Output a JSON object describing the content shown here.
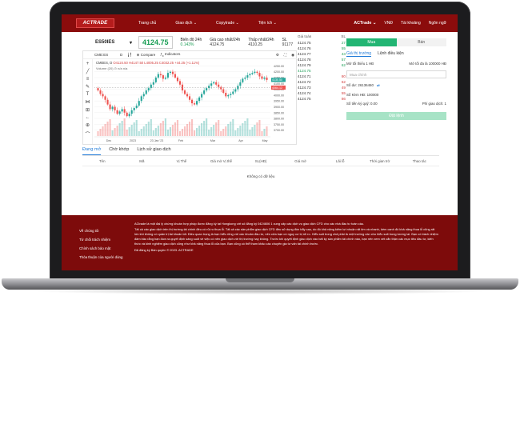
{
  "topbar": {
    "logo": "ACTRADE",
    "nav": [
      "Trang chủ",
      "Giao dịch ⌄",
      "Copytrade ⌄",
      "Tiện ích ⌄"
    ],
    "account": "ACTrade ⌄",
    "currency": "VNĐ",
    "profile": "Tài khoảng",
    "language": "Ngôn ngữ"
  },
  "symbol": {
    "name": "ES50IES",
    "price": "4124.75",
    "stats": [
      {
        "label": "Biến độ 24h",
        "value": "0.143%",
        "green": true
      },
      {
        "label": "Giá cao nhất/24h",
        "value": "4124.75",
        "green": false
      },
      {
        "label": "Thấp nhất/24h",
        "value": "4110.25",
        "green": false
      },
      {
        "label": "SL",
        "value": "91177",
        "green": false
      }
    ]
  },
  "tv": {
    "symbol": "CME:ES",
    "interval": "D",
    "compare": "Compare",
    "indicators": "Indicators",
    "info_symbol": "CMEES, D",
    "ohlc": "O4124.50  H4147.50  L4005.25  C4032.25  +44.25 (+1.11%)",
    "volume": "Volume (20)  ⊙  n/a  n/a"
  },
  "chart_data": {
    "type": "candlestick",
    "title": "",
    "x_ticks": [
      "Dec",
      "2023",
      "23 Jan '23",
      "Feb",
      "Mar",
      "Apr",
      "May"
    ],
    "y_ticks": [
      "4250.00",
      "4200.00",
      "4150.00",
      "4100.00",
      "4050.00",
      "4000.00",
      "3950.00",
      "3900.00",
      "3850.00",
      "3800.00",
      "3750.00",
      "3700.00"
    ],
    "ylim": [
      3650,
      4280
    ],
    "last_price": "4130.50",
    "reference_price": "4064.12",
    "up_color": "#26a69a",
    "down_color": "#ef5350",
    "closes": [
      4040,
      4010,
      3990,
      3960,
      3920,
      3880,
      3900,
      3870,
      3840,
      3860,
      3880,
      3850,
      3820,
      3840,
      3870,
      3890,
      3910,
      3950,
      3990,
      4010,
      4040,
      4060,
      4090,
      4110,
      4150,
      4180,
      4170,
      4140,
      4150,
      4190,
      4200,
      4180,
      4150,
      4120,
      4090,
      4040,
      4010,
      3990,
      3960,
      3930,
      3920,
      3950,
      3980,
      4010,
      4040,
      4060,
      4080,
      4100,
      4110,
      4090,
      4070,
      4050,
      4020,
      3990,
      4000,
      4010,
      4030,
      4050,
      4080,
      4110,
      4140,
      4150,
      4170,
      4180,
      4190,
      4200,
      4190,
      4160,
      4140,
      4150,
      4130
    ]
  },
  "orderbook": {
    "h_price": "Giá toàn",
    "h_size": "SL",
    "rows": [
      {
        "price": "4124.75",
        "size": "27",
        "side": "g"
      },
      {
        "price": "4124.76",
        "size": "55",
        "side": "g"
      },
      {
        "price": "4124.77",
        "size": "43",
        "side": "g"
      },
      {
        "price": "4124.78",
        "size": "57",
        "side": "g"
      },
      {
        "price": "4124.79",
        "size": "62",
        "side": "g"
      },
      {
        "price": "4124.75",
        "size": "",
        "side": "mid"
      },
      {
        "price": "4124.71",
        "size": "80",
        "side": "r"
      },
      {
        "price": "4124.72",
        "size": "62",
        "side": "r"
      },
      {
        "price": "4124.73",
        "size": "49",
        "side": "r"
      },
      {
        "price": "4124.74",
        "size": "55",
        "side": "r"
      },
      {
        "price": "4124.75",
        "size": "86",
        "side": "r"
      }
    ]
  },
  "trade": {
    "buy": "Mua",
    "sell": "Bán",
    "order_types": [
      "Giá thị trường",
      "Lệnh điều kiện"
    ],
    "min_label": "Mở tối thiểu 1 HĐ",
    "max_label": "Mở tối đa là 100000 HĐ",
    "qty_placeholder": "Mua chính",
    "balance": "Số dư: 26136460",
    "contracts": "Số Kèm HĐ: 100000",
    "margin": "Số tiền ký quỹ: 0.00",
    "fee": "Phí giao dịch: 1",
    "submit": "Đặt lệnh"
  },
  "orders": {
    "tabs": [
      "Đang mở",
      "Chờ khớp",
      "Lịch sử giao dịch"
    ],
    "columns": [
      "Tên",
      "Mã",
      "Vị Thế",
      "Giá mở Vị thế",
      "SL(HĐ)",
      "Giá mở",
      "Lãi lỗ",
      "Thời gian trở",
      "Thao tác"
    ],
    "empty": "Không có dữ liệu"
  },
  "footer": {
    "links": [
      "Về chúng tôi",
      "Từ chối trách nhiệm",
      "Chính sách bảo mật",
      "Thỏa thuận của người dùng"
    ],
    "paragraphs": [
      "ACtrade là một đại lý chứng khoán hợp pháp được đăng ký tại Hongkong với số đăng ký 0424606 1 cung cấp các dịch vụ giao dịch CFD cho các nhà đầu tư toàn cầu.",
      "Tất cả các giao dịch trên thị trường tài chính đều có rủi ro thua lỗ. Tất cả các sản phẩm giao dịch CFD đều sử dụng đòn bẩy cao, do đó khả năng kiếm lợi nhuận rất lớn và nhanh, kèm canh đó khả năng thua lỗ cũng rất lớn khi không có quản trị tài khoản tốt. Điều quan trọng là bạn hiểu rõng với các khoản đầu tư, nên cửa bạn có nguy cơ bị rủi ro. Hiểu sult trong chấ phải là một trường cần cho hiểu sult trong tương lai. Bạn có trách nhiệm đảm bảo rằng bạn đưa ra quyết định sáng suốt về việc có nên giao dịch với thị trường hay không. Trước khi quyết định giao dịch vào bất kỳ sản phẩm tài chính nào, bạn nên xem xét cẩn thận các mục tiêu đầu tư, kiến thức và kinh nghiệm giao dịch cũng như khả năng thua lỗ của bạn. Bạn cũng có thể tham khảo các chuyên gia tư vấn tài chính trước.",
      "Đã đăng ký Bản quyền © 2023. ACTRADE"
    ]
  }
}
